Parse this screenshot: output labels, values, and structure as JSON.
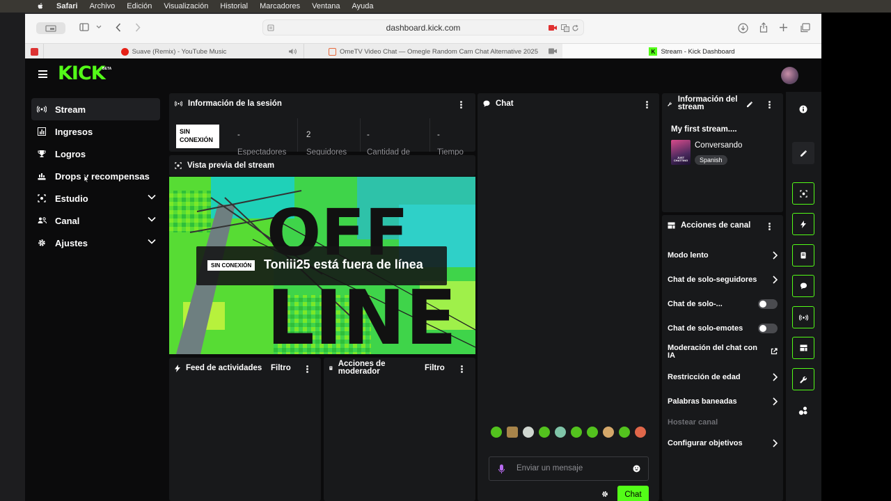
{
  "mac_menu": {
    "app": "Safari",
    "items": [
      "Archivo",
      "Edición",
      "Visualización",
      "Historial",
      "Marcadores",
      "Ventana",
      "Ayuda"
    ]
  },
  "browser": {
    "url": "dashboard.kick.com",
    "tabs": [
      {
        "title": "Suave (Remix) - YouTube Music"
      },
      {
        "title": "OmeTV Video Chat — Omegle Random Cam Chat Alternative 2025"
      },
      {
        "title": "Stream - Kick Dashboard"
      }
    ]
  },
  "kick": {
    "logo": "KICK",
    "beta": "BETA",
    "sidebar": [
      {
        "label": "Stream",
        "icon": "broadcast-icon"
      },
      {
        "label": "Ingresos",
        "icon": "chart-icon"
      },
      {
        "label": "Logros",
        "icon": "trophy-icon"
      },
      {
        "label": "Drops y recompensas",
        "icon": "gift-icon"
      },
      {
        "label": "Estudio",
        "icon": "studio-icon"
      },
      {
        "label": "Canal",
        "icon": "users-icon"
      },
      {
        "label": "Ajustes",
        "icon": "gear-icon"
      }
    ],
    "session": {
      "title": "Información de la sesión",
      "badge": "SIN CONEXIÓN",
      "stats": [
        {
          "value": "-",
          "label": "Espectadores"
        },
        {
          "value": "2",
          "label": "Seguidores"
        },
        {
          "value": "-",
          "label": "Cantidad de"
        },
        {
          "value": "-",
          "label": "Tiempo"
        }
      ]
    },
    "preview": {
      "title": "Vista previa del stream",
      "badge": "SIN CONEXIÓN",
      "message": "Toniii25 está fuera de línea",
      "bg_text_1": "OFF",
      "bg_text_2": "LINE"
    },
    "activity": {
      "title": "Feed de actividades",
      "filter": "Filtro"
    },
    "mod_actions": {
      "title": "Acciones de moderador",
      "filter": "Filtro"
    },
    "chat": {
      "title": "Chat",
      "placeholder": "Enviar un mensaje",
      "send": "Chat"
    },
    "stream_info": {
      "title": "Información del stream",
      "stream_title": "My first stream....",
      "category": "Conversando",
      "language": "Spanish",
      "thumb_text": "JUST CHATTING"
    },
    "channel_actions": {
      "title": "Acciones de canal",
      "items": [
        {
          "label": "Modo lento"
        },
        {
          "label": "Chat de solo-seguidores"
        },
        {
          "label": "Chat de solo-..."
        },
        {
          "label": "Chat de solo-emotes"
        },
        {
          "label": "Moderación del chat con IA"
        },
        {
          "label": "Restricción de edad"
        },
        {
          "label": "Palabras baneadas"
        },
        {
          "label": "Hostear canal"
        },
        {
          "label": "Configurar objetivos"
        }
      ]
    },
    "colors": {
      "accent": "#53fc18",
      "panel": "#18191b",
      "bg": "#0b0b0c"
    }
  }
}
